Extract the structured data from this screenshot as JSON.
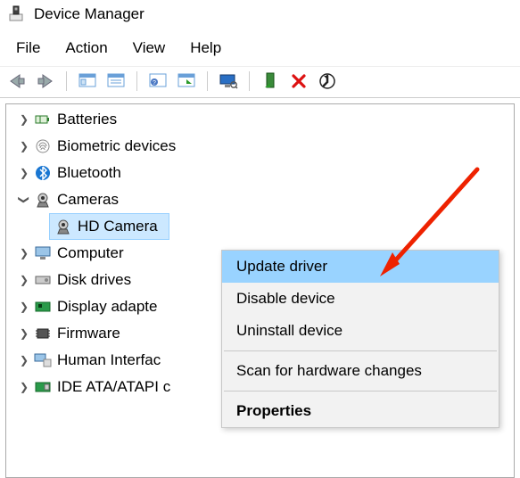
{
  "window": {
    "title": "Device Manager"
  },
  "menubar": {
    "file": "File",
    "action": "Action",
    "view": "View",
    "help": "Help"
  },
  "toolbar_icons": {
    "back": "back-arrow-icon",
    "forward": "forward-arrow-icon",
    "show": "show-pane-icon",
    "props": "properties-icon",
    "help": "help-icon",
    "update": "update-driver-icon",
    "monitor": "monitor-icon",
    "install": "install-icon",
    "remove": "remove-icon",
    "scan": "scan-icon"
  },
  "tree": {
    "batteries": "Batteries",
    "biometric": "Biometric devices",
    "bluetooth": "Bluetooth",
    "cameras": "Cameras",
    "hd_camera": "HD Camera",
    "computer": "Computer",
    "disk_drives": "Disk drives",
    "display_adapters": "Display adapte",
    "firmware": "Firmware",
    "human_interface": "Human Interfac",
    "ide": "IDE ATA/ATAPI c"
  },
  "context_menu": {
    "update": "Update driver",
    "disable": "Disable device",
    "uninstall": "Uninstall device",
    "scan": "Scan for hardware changes",
    "properties": "Properties"
  }
}
